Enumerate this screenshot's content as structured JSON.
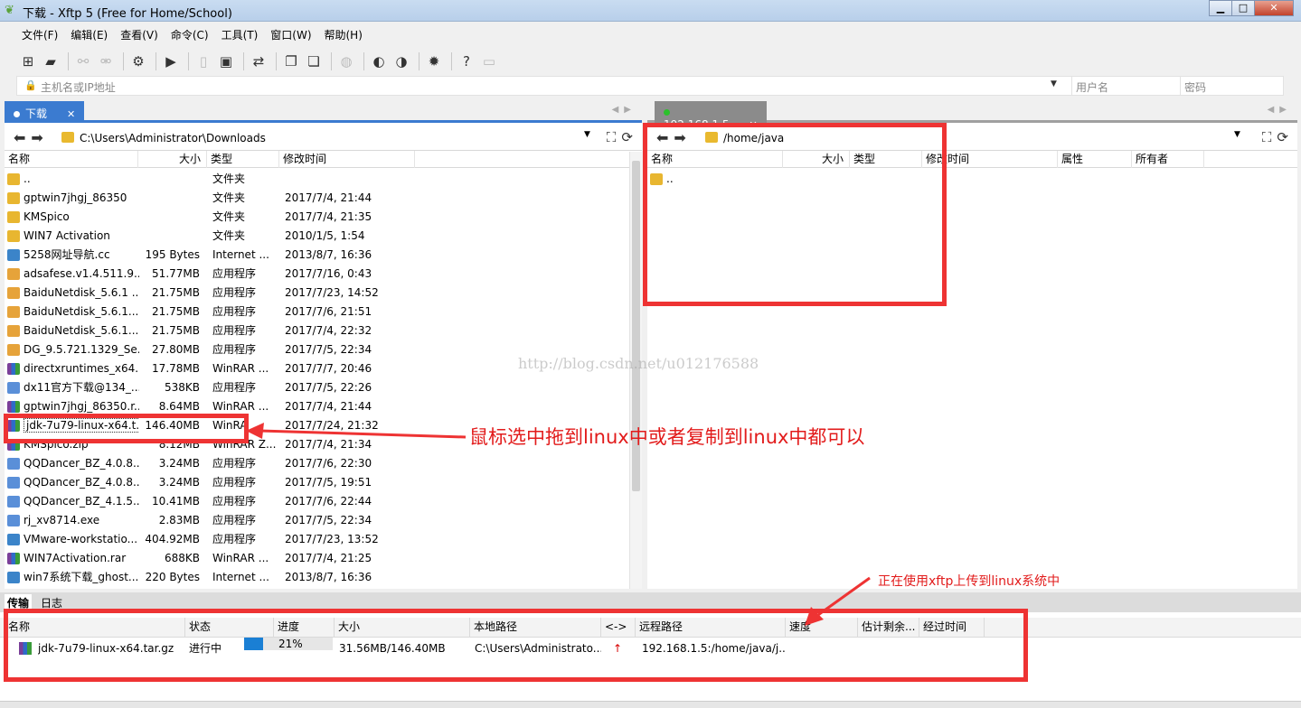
{
  "window": {
    "title": "下载 - Xftp 5 (Free for Home/School)",
    "buttons": {
      "minimize": "▁",
      "maximize": "□",
      "close": "✕"
    }
  },
  "menu": [
    "文件(F)",
    "编辑(E)",
    "查看(V)",
    "命令(C)",
    "工具(T)",
    "窗口(W)",
    "帮助(H)"
  ],
  "address_bar": {
    "host_placeholder": "主机名或IP地址",
    "user_placeholder": "用户名",
    "password_placeholder": "密码"
  },
  "left_pane": {
    "tab_label": "下载",
    "path": "C:\\Users\\Administrator\\Downloads",
    "columns": [
      "名称",
      "大小",
      "类型",
      "修改时间"
    ],
    "files": [
      {
        "name": "..",
        "size": "",
        "type": "文件夹",
        "modified": "",
        "icon": "folder"
      },
      {
        "name": "gptwin7jhgj_86350",
        "size": "",
        "type": "文件夹",
        "modified": "2017/7/4, 21:44",
        "icon": "folder"
      },
      {
        "name": "KMSpico",
        "size": "",
        "type": "文件夹",
        "modified": "2017/7/4, 21:35",
        "icon": "folder"
      },
      {
        "name": "WIN7 Activation",
        "size": "",
        "type": "文件夹",
        "modified": "2010/1/5, 1:54",
        "icon": "folder"
      },
      {
        "name": "5258网址导航.cc",
        "size": "195 Bytes",
        "type": "Internet ...",
        "modified": "2013/8/7, 16:36",
        "icon": "web"
      },
      {
        "name": "adsafese.v1.4.511.9...",
        "size": "51.77MB",
        "type": "应用程序",
        "modified": "2017/7/16, 0:43",
        "icon": "app"
      },
      {
        "name": "BaiduNetdisk_5.6.1 ...",
        "size": "21.75MB",
        "type": "应用程序",
        "modified": "2017/7/23, 14:52",
        "icon": "app"
      },
      {
        "name": "BaiduNetdisk_5.6.1....",
        "size": "21.75MB",
        "type": "应用程序",
        "modified": "2017/7/6, 21:51",
        "icon": "app"
      },
      {
        "name": "BaiduNetdisk_5.6.1....",
        "size": "21.75MB",
        "type": "应用程序",
        "modified": "2017/7/4, 22:32",
        "icon": "app"
      },
      {
        "name": "DG_9.5.721.1329_Se...",
        "size": "27.80MB",
        "type": "应用程序",
        "modified": "2017/7/5, 22:34",
        "icon": "app"
      },
      {
        "name": "directxruntimes_x64...",
        "size": "17.78MB",
        "type": "WinRAR ...",
        "modified": "2017/7/7, 20:46",
        "icon": "rar"
      },
      {
        "name": "dx11官方下载@134_...",
        "size": "538KB",
        "type": "应用程序",
        "modified": "2017/7/5, 22:26",
        "icon": "gear"
      },
      {
        "name": "gptwin7jhgj_86350.r...",
        "size": "8.64MB",
        "type": "WinRAR ...",
        "modified": "2017/7/4, 21:44",
        "icon": "rar"
      },
      {
        "name": "jdk-7u79-linux-x64.t...",
        "size": "146.40MB",
        "type": "WinRA",
        "modified": "2017/7/24, 21:32",
        "icon": "rar",
        "selected": true
      },
      {
        "name": "KMSpico.zip",
        "size": "8.12MB",
        "type": "WinRAR Z...",
        "modified": "2017/7/4, 21:34",
        "icon": "rar"
      },
      {
        "name": "QQDancer_BZ_4.0.8....",
        "size": "3.24MB",
        "type": "应用程序",
        "modified": "2017/7/6, 22:30",
        "icon": "gear"
      },
      {
        "name": "QQDancer_BZ_4.0.8....",
        "size": "3.24MB",
        "type": "应用程序",
        "modified": "2017/7/5, 19:51",
        "icon": "gear"
      },
      {
        "name": "QQDancer_BZ_4.1.5....",
        "size": "10.41MB",
        "type": "应用程序",
        "modified": "2017/7/6, 22:44",
        "icon": "gear"
      },
      {
        "name": "rj_xv8714.exe",
        "size": "2.83MB",
        "type": "应用程序",
        "modified": "2017/7/5, 22:34",
        "icon": "gear"
      },
      {
        "name": "VMware-workstatio...",
        "size": "404.92MB",
        "type": "应用程序",
        "modified": "2017/7/23, 13:52",
        "icon": "web"
      },
      {
        "name": "WIN7Activation.rar",
        "size": "688KB",
        "type": "WinRAR ...",
        "modified": "2017/7/4, 21:25",
        "icon": "rar"
      },
      {
        "name": "win7系统下载_ghost...",
        "size": "220 Bytes",
        "type": "Internet ...",
        "modified": "2013/8/7, 16:36",
        "icon": "web"
      }
    ]
  },
  "right_pane": {
    "tab_label": "192.168.1.5",
    "path": "/home/java",
    "columns": [
      "名称",
      "大小",
      "类型",
      "修改时间",
      "属性",
      "所有者"
    ],
    "files": [
      {
        "name": "..",
        "icon": "folder"
      }
    ]
  },
  "transfer": {
    "tabs": [
      "传输",
      "日志"
    ],
    "columns": [
      "名称",
      "状态",
      "进度",
      "大小",
      "本地路径",
      "<->",
      "远程路径",
      "速度",
      "估计剩余...",
      "经过时间"
    ],
    "rows": [
      {
        "name": "jdk-7u79-linux-x64.tar.gz",
        "status": "进行中",
        "progress_pct": 21,
        "progress_label": "21%",
        "size": "31.56MB/146.40MB",
        "local_path": "C:\\Users\\Administrato...",
        "direction": "↑",
        "remote_path": "192.168.1.5:/home/java/j...",
        "speed": "",
        "eta": "",
        "elapsed": ""
      }
    ]
  },
  "annotations": {
    "drag_note": "鼠标选中拖到linux中或者复制到linux中都可以",
    "upload_note": "正在使用xftp上传到linux系统中",
    "watermark": "http://blog.csdn.net/u012176588"
  },
  "colors": {
    "accent": "#3b7bd0",
    "annotation_red": "#ee3333",
    "progress_fill": "#1a7fd4"
  }
}
